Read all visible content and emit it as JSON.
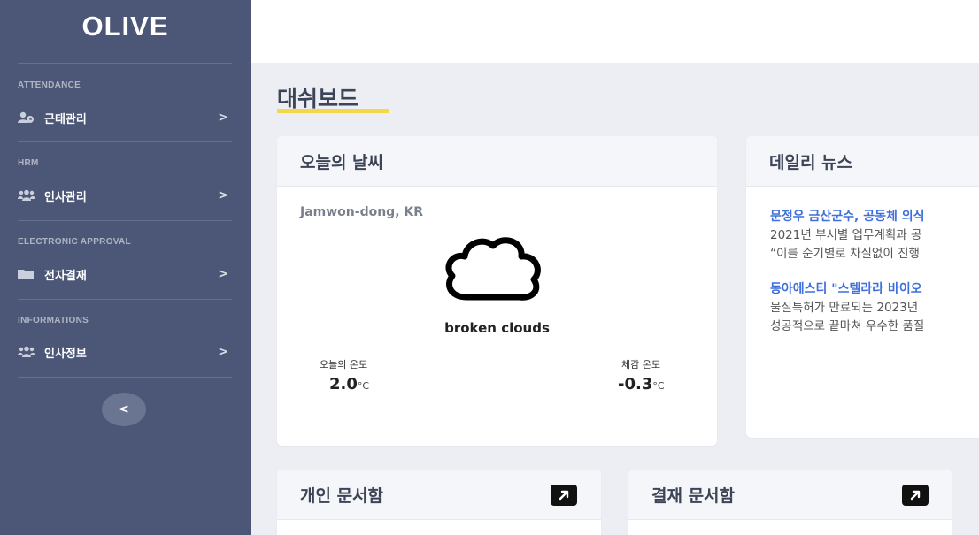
{
  "app": {
    "logo": "OLIVE"
  },
  "sidebar": {
    "sections": [
      {
        "title": "ATTENDANCE",
        "item": {
          "label": "근태관리",
          "icon": "user-clock-icon"
        }
      },
      {
        "title": "HRM",
        "item": {
          "label": "인사관리",
          "icon": "users-icon"
        }
      },
      {
        "title": "ELECTRONIC APPROVAL",
        "item": {
          "label": "전자결재",
          "icon": "folder-icon"
        }
      },
      {
        "title": "INFORMATIONS",
        "item": {
          "label": "인사정보",
          "icon": "users-icon"
        }
      }
    ],
    "chevron": ">",
    "collapse_label": "<"
  },
  "page": {
    "title": "대쉬보드"
  },
  "weather": {
    "title": "오늘의 날씨",
    "location": "Jamwon-dong, KR",
    "icon": "cloud-icon",
    "description": "broken clouds",
    "today_label": "오늘의 온도",
    "today_value": "2.0",
    "feels_label": "체감 온도",
    "feels_value": "-0.3",
    "unit": "°C"
  },
  "news": {
    "title": "데일리 뉴스",
    "items": [
      {
        "headline": "문정우 금산군수, 공동체 의식",
        "summary": [
          " 2021년 부서별 업무계획과 공",
          "“이를 순기별로 차질없이 진행"
        ]
      },
      {
        "headline": "동아에스티 \"스텔라라 바이오",
        "summary": [
          "물질특허가 만료되는 2023년",
          "성공적으로 끝마쳐 우수한 품질"
        ]
      }
    ]
  },
  "docs": {
    "personal_title": "개인 문서함",
    "approval_title": "결재 문서함",
    "open_icon": "external-link-icon"
  },
  "colors": {
    "sidebar": "#4c5777",
    "accent_underline": "#f5d84a",
    "link": "#3f6fdc"
  }
}
